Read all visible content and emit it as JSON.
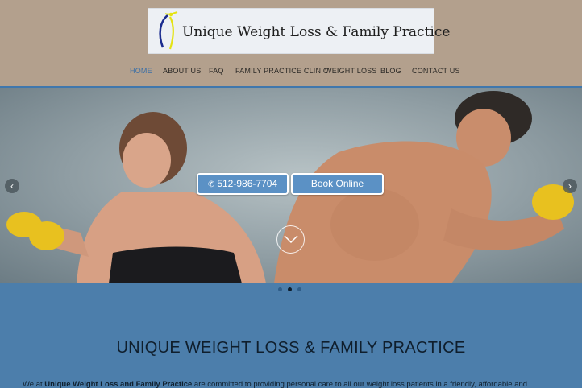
{
  "header": {
    "logo_text": "Unique Weight Loss & Family Practice",
    "nav": [
      {
        "label": "HOME",
        "active": true
      },
      {
        "label": "ABOUT US"
      },
      {
        "label": "FAQ"
      },
      {
        "label": "FAMILY PRACTICE CLINIC"
      },
      {
        "label": "WEIGHT LOSS"
      },
      {
        "label": "BLOG"
      },
      {
        "label": "CONTACT US"
      }
    ]
  },
  "hero": {
    "phone_label": "512-986-7704",
    "book_label": "Book Online",
    "slides": 3,
    "active_slide": 2
  },
  "content": {
    "title": "UNIQUE WEIGHT LOSS & FAMILY PRACTICE",
    "intro_prefix": "We at ",
    "intro_bold": "Unique Weight Loss and Family Practice",
    "intro_suffix": " are committed to providing personal care to all our weight loss patients in a friendly, affordable and"
  },
  "colors": {
    "header_bg": "#b3a08d",
    "nav_active": "#3b6fa6",
    "body_bg": "#4c7eab",
    "button_bg": "#5b91c5"
  },
  "icons": [
    "logo-figure-icon",
    "chevron-left-icon",
    "chevron-right-icon",
    "phone-icon",
    "chevron-down-icon"
  ]
}
